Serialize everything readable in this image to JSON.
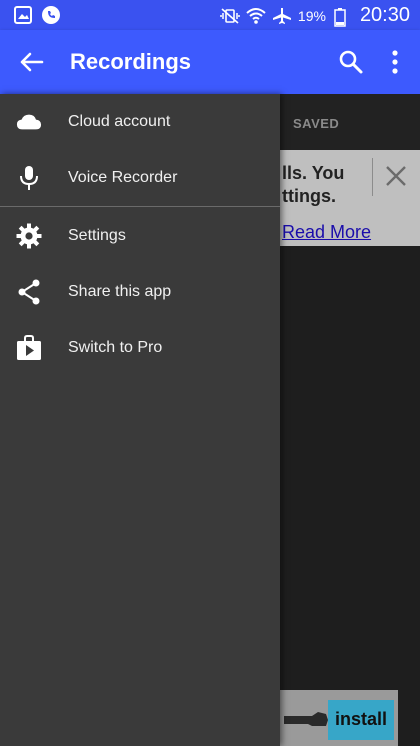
{
  "status_bar": {
    "battery_percent": "19%",
    "time": "20:30"
  },
  "app_bar": {
    "title": "Recordings"
  },
  "tabs": {
    "saved_label": "SAVED"
  },
  "ad": {
    "text": "lls. You\nttings.",
    "link": "Read More",
    "install_label": "install"
  },
  "drawer": {
    "items": [
      {
        "label": "Cloud account",
        "icon": "cloud-icon"
      },
      {
        "label": "Voice Recorder",
        "icon": "microphone-icon"
      },
      {
        "label": "Settings",
        "icon": "gear-icon"
      },
      {
        "label": "Share this app",
        "icon": "share-icon"
      },
      {
        "label": "Switch to Pro",
        "icon": "play-store-icon"
      }
    ]
  },
  "colors": {
    "primary": "#3d5afe",
    "drawer_bg": "#3a3a3a"
  }
}
